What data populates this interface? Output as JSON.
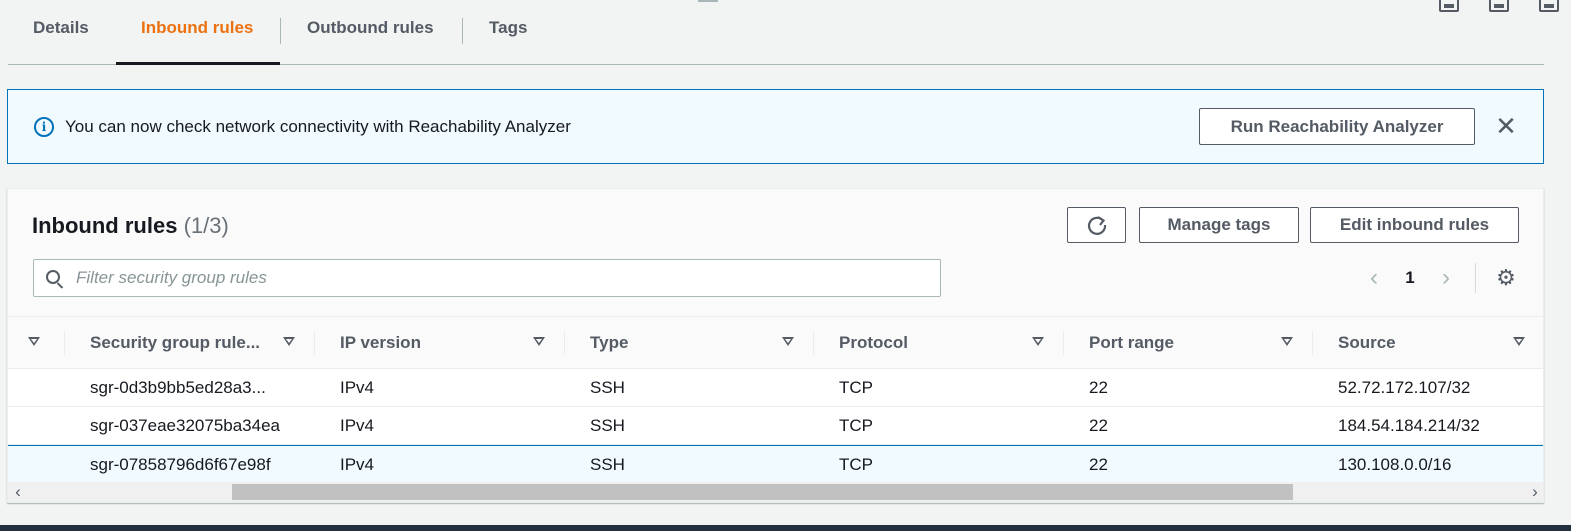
{
  "tabs": [
    {
      "label": "Details"
    },
    {
      "label": "Inbound rules",
      "active": true
    },
    {
      "label": "Outbound rules"
    },
    {
      "label": "Tags"
    }
  ],
  "flash": {
    "message": "You can now check network connectivity with Reachability Analyzer",
    "action_label": "Run Reachability Analyzer"
  },
  "panel": {
    "title": "Inbound rules",
    "count": "(1/3)",
    "manage_tags_label": "Manage tags",
    "edit_rules_label": "Edit inbound rules",
    "search_placeholder": "Filter security group rules",
    "page": "1"
  },
  "table": {
    "columns": [
      "Security group rule...",
      "IP version",
      "Type",
      "Protocol",
      "Port range",
      "Source"
    ],
    "rows": [
      {
        "id": "sgr-0d3b9bb5ed28a3...",
        "ip_version": "IPv4",
        "type": "SSH",
        "protocol": "TCP",
        "port_range": "22",
        "source": "52.72.172.107/32",
        "selected": false
      },
      {
        "id": "sgr-037eae32075ba34ea",
        "ip_version": "IPv4",
        "type": "SSH",
        "protocol": "TCP",
        "port_range": "22",
        "source": "184.54.184.214/32",
        "selected": false
      },
      {
        "id": "sgr-07858796d6f67e98f",
        "ip_version": "IPv4",
        "type": "SSH",
        "protocol": "TCP",
        "port_range": "22",
        "source": "130.108.0.0/16",
        "selected": true
      }
    ]
  },
  "colors": {
    "accent": "#ec7211",
    "info_blue": "#0073bb",
    "info_bg": "#f1faff"
  }
}
